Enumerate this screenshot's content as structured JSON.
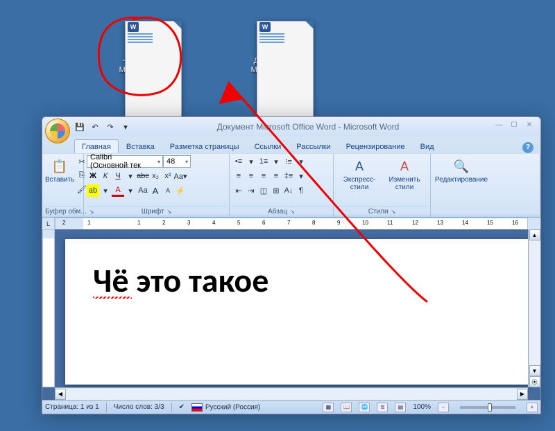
{
  "desktop": {
    "icons": [
      {
        "label1": "~$кумент",
        "label2": "Microsoft ..."
      },
      {
        "label1": "Документ",
        "label2": "Microsoft ..."
      }
    ]
  },
  "window": {
    "title": "Документ Microsoft Office Word - Microsoft Word",
    "qat": {
      "save": "💾",
      "undo": "↶",
      "redo": "↷",
      "more": "▾"
    },
    "minimize": "—",
    "maximize": "☐",
    "close": "✕",
    "help": "?"
  },
  "tabs": {
    "home": "Главная",
    "insert": "Вставка",
    "layout": "Разметка страницы",
    "refs": "Ссылки",
    "mail": "Рассылки",
    "review": "Рецензирование",
    "view": "Вид"
  },
  "ribbon": {
    "clipboard": {
      "label": "Буфер обм...",
      "paste": "Вставить"
    },
    "font": {
      "label": "Шрифт",
      "font_name": "Calibri (Основной тек",
      "font_size": "48",
      "bold": "Ж",
      "italic": "К",
      "underline": "Ч",
      "strike": "abc",
      "sub": "x₂",
      "sup": "x²",
      "hilite": "ab",
      "fcolor": "A",
      "case": "Aa",
      "grow": "A",
      "shrink": "A",
      "clear": "⌫"
    },
    "paragraph": {
      "label": "Абзац"
    },
    "styles": {
      "label": "Стили",
      "quick": "Экспресс-стили",
      "change": "Изменить стили"
    },
    "editing": {
      "label": "Редактирование"
    }
  },
  "ruler": {
    "h": [
      "2",
      "1",
      "",
      "1",
      "2",
      "3",
      "4",
      "5",
      "6",
      "7",
      "8",
      "9",
      "10",
      "11",
      "12",
      "13",
      "14",
      "15",
      "16"
    ]
  },
  "document": {
    "text": "Чё это такое"
  },
  "status": {
    "page": "Страница: 1 из 1",
    "words": "Число слов: 3/3",
    "lang": "Русский (Россия)",
    "zoom": "100%",
    "zminus": "−",
    "zplus": "+"
  }
}
